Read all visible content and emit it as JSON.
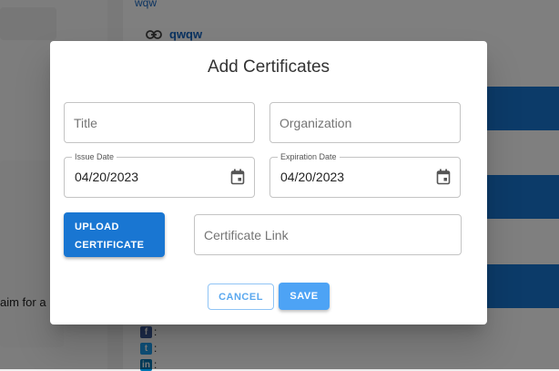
{
  "background": {
    "top_link_text": "wqw",
    "link_item_text": "qwqw",
    "left_text": "aim for a",
    "social_separator": ":"
  },
  "dialog": {
    "title": "Add Certificates",
    "title_field": {
      "placeholder": "Title",
      "value": ""
    },
    "organization_field": {
      "placeholder": "Organization",
      "value": ""
    },
    "issue_date": {
      "label": "Issue Date",
      "value": "04/20/2023"
    },
    "expiration_date": {
      "label": "Expiration Date",
      "value": "04/20/2023"
    },
    "upload_button": {
      "line1": "UPLOAD",
      "line2": "CERTIFICATE"
    },
    "certificate_link_field": {
      "placeholder": "Certificate Link",
      "value": ""
    },
    "cancel_label": "CANCEL",
    "save_label": "SAVE"
  },
  "colors": {
    "primary": "#1976d2",
    "save_button": "#4da3f5",
    "cancel_text": "#5aa8ef",
    "overlay": "rgba(0,0,0,0.5)"
  },
  "icons": {
    "link": "link-icon",
    "calendar": "calendar-icon",
    "facebook": "facebook-icon",
    "twitter": "twitter-icon",
    "linkedin": "linkedin-icon"
  }
}
